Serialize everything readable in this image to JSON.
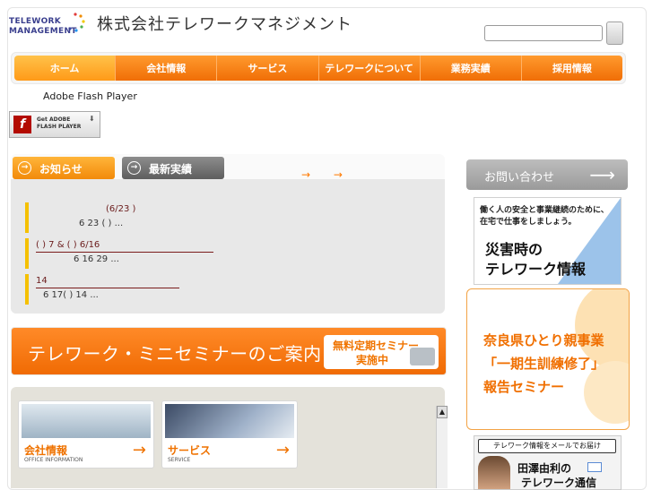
{
  "header": {
    "logo_line1": "TELEWORK",
    "logo_line2": "MANAGEMENT",
    "company_name": "株式会社テレワークマネジメント"
  },
  "nav": {
    "items": [
      "ホーム",
      "会社情報",
      "サービス",
      "テレワークについて",
      "業務実績",
      "採用情報"
    ]
  },
  "flash": {
    "text": "Adobe Flash Player",
    "badge_line1": "Get ADOBE",
    "badge_line2": "FLASH PLAYER",
    "badge_icon": "f"
  },
  "tabs": {
    "news": "お知らせ",
    "works": "最新実績",
    "more1": "→＿",
    "more2": "→＿"
  },
  "news": [
    {
      "line1": "(6/23 )",
      "line2": "6 23 ( )      ..."
    },
    {
      "line1": "( )      7      &                              ( ) 6/16",
      "line2": "6 16  29            ..."
    },
    {
      "line1": "14",
      "line2": "6 17( ) 14                     ..."
    }
  ],
  "seminar": {
    "title": "テレワーク・ミニセミナーのご案内",
    "badge_line1": "無料定期セミナー",
    "badge_line2": "実施中"
  },
  "cards": [
    {
      "title": "会社情報",
      "subtitle": "OFFICE INFORMATION"
    },
    {
      "title": "サービス",
      "subtitle": "SERVICE"
    }
  ],
  "sidebar": {
    "contact": "お問い合わせ",
    "disaster_line1": "働く人の安全と事業継続のために、",
    "disaster_line2": "在宅で仕事をしましょう。",
    "disaster_line3": "災害時の",
    "disaster_line4": "テレワーク情報",
    "nara_line1": "奈良県ひとり親事業",
    "nara_line2": "「一期生訓練修了」",
    "nara_line3": "報告セミナー",
    "mail_line1": "テレワーク情報をメールでお届け",
    "mail_line2": "田澤由利の",
    "mail_line3": "テレワーク通信"
  },
  "colors": {
    "accent": "#f07400",
    "nav_orange": "#f06e06",
    "highlight_yellow": "#f5c000"
  }
}
